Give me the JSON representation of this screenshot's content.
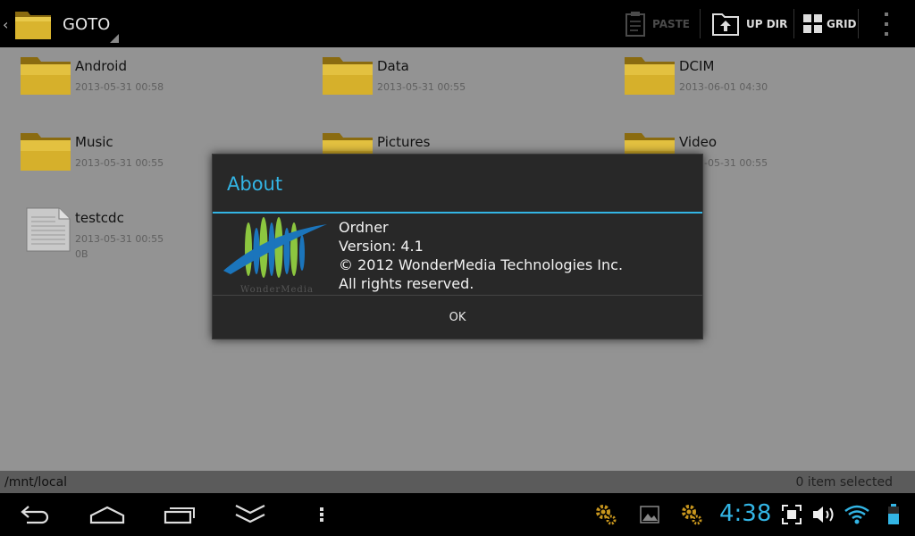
{
  "actionbar": {
    "title": "GOTO",
    "paste_label": "PASTE",
    "updir_label": "UP DIR",
    "grid_label": "GRID"
  },
  "files": [
    {
      "name": "Android",
      "date": "2013-05-31 00:58",
      "type": "folder"
    },
    {
      "name": "Data",
      "date": "2013-05-31 00:55",
      "type": "folder"
    },
    {
      "name": "DCIM",
      "date": "2013-06-01 04:30",
      "type": "folder"
    },
    {
      "name": "Music",
      "date": "2013-05-31 00:55",
      "type": "folder"
    },
    {
      "name": "Pictures",
      "date": "",
      "type": "folder"
    },
    {
      "name": "Video",
      "date": "-05-31 00:55",
      "type": "folder"
    },
    {
      "name": "testcdc",
      "date": "2013-05-31 00:55",
      "size": "0B",
      "type": "file"
    }
  ],
  "status": {
    "path": "/mnt/local",
    "selection": "0 item selected"
  },
  "dialog": {
    "title": "About",
    "app_name": "Ordner",
    "version": "Version: 4.1",
    "copyright": "© 2012 WonderMedia Technologies Inc.",
    "rights": "All rights reserved.",
    "ok_label": "OK",
    "logo_text": "WonderMedia"
  },
  "systembar": {
    "time": "4:38"
  },
  "colors": {
    "accent": "#33b5e5",
    "folder": "#d9b42e",
    "logo_green": "#8cc63f",
    "logo_blue": "#1b75bc"
  }
}
